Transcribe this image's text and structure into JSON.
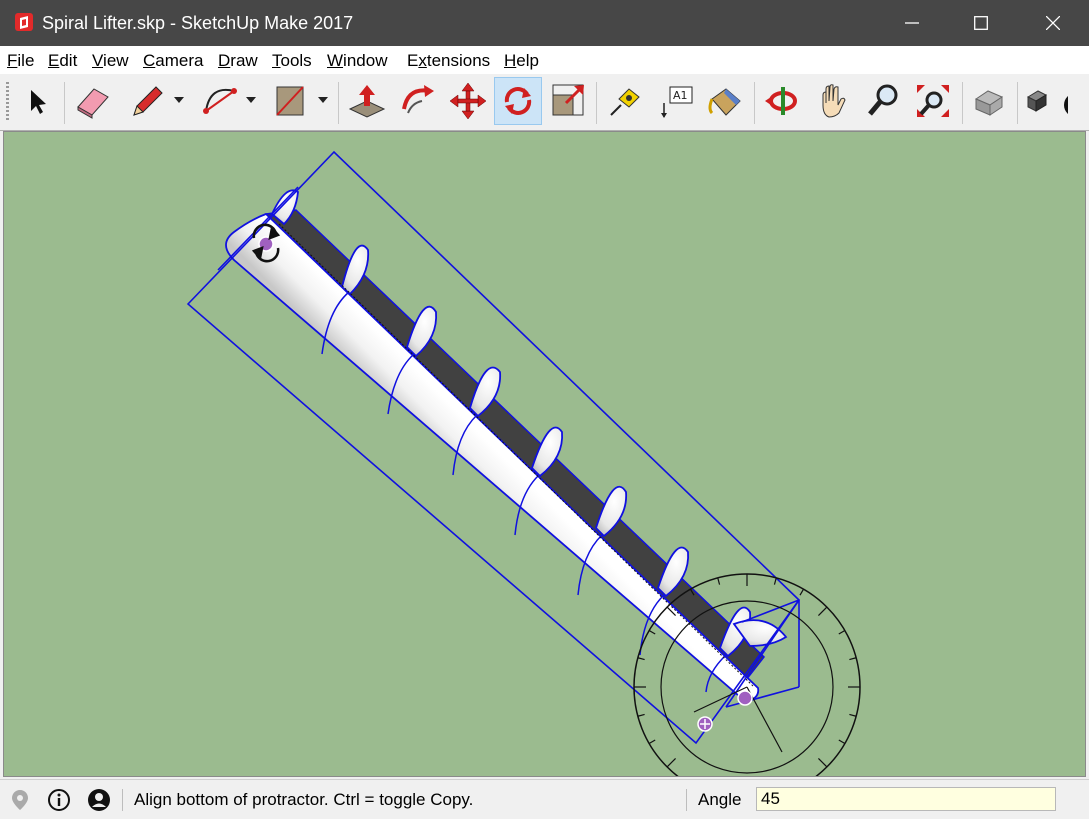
{
  "window": {
    "title": "Spiral Lifter.skp - SketchUp Make 2017",
    "icon": "sketchup-logo-icon",
    "controls": [
      "minimize-icon",
      "maximize-icon",
      "close-icon"
    ]
  },
  "menu": {
    "items": [
      {
        "label": "File",
        "key": "F",
        "rest": "ile"
      },
      {
        "label": "Edit",
        "key": "E",
        "rest": "dit"
      },
      {
        "label": "View",
        "key": "V",
        "rest": "iew"
      },
      {
        "label": "Camera",
        "key": "C",
        "rest": "amera"
      },
      {
        "label": "Draw",
        "key": "D",
        "rest": "raw"
      },
      {
        "label": "Tools",
        "key": "T",
        "rest": "ools"
      },
      {
        "label": "Window",
        "key": "W",
        "rest": "indow"
      },
      {
        "label": "Extensions",
        "key": "x",
        "pre": "E",
        "rest": "tensions"
      },
      {
        "label": "Help",
        "key": "H",
        "rest": "elp"
      }
    ]
  },
  "toolbar": {
    "tools": [
      "select",
      "eraser",
      "pencil",
      "arc",
      "rectangle",
      "push-pull",
      "follow-me",
      "move",
      "rotate",
      "scale",
      "tape-measure",
      "text",
      "paint-bucket",
      "orbit",
      "pan",
      "zoom",
      "zoom-extents",
      "warehouse",
      "components"
    ],
    "active_tool": "rotate"
  },
  "status": {
    "message": "Align bottom of protractor.  Ctrl = toggle Copy.",
    "measurement_label": "Angle",
    "measurement_value": "45",
    "icons": [
      "geo-location-icon",
      "info-icon",
      "user-account-icon"
    ]
  },
  "colors": {
    "titlebar": "#474747",
    "viewport_background": "#9bbb8f",
    "selection": "#1010e0",
    "active_tool": "#cce4f7",
    "measurement_box": "#ffffe0"
  }
}
